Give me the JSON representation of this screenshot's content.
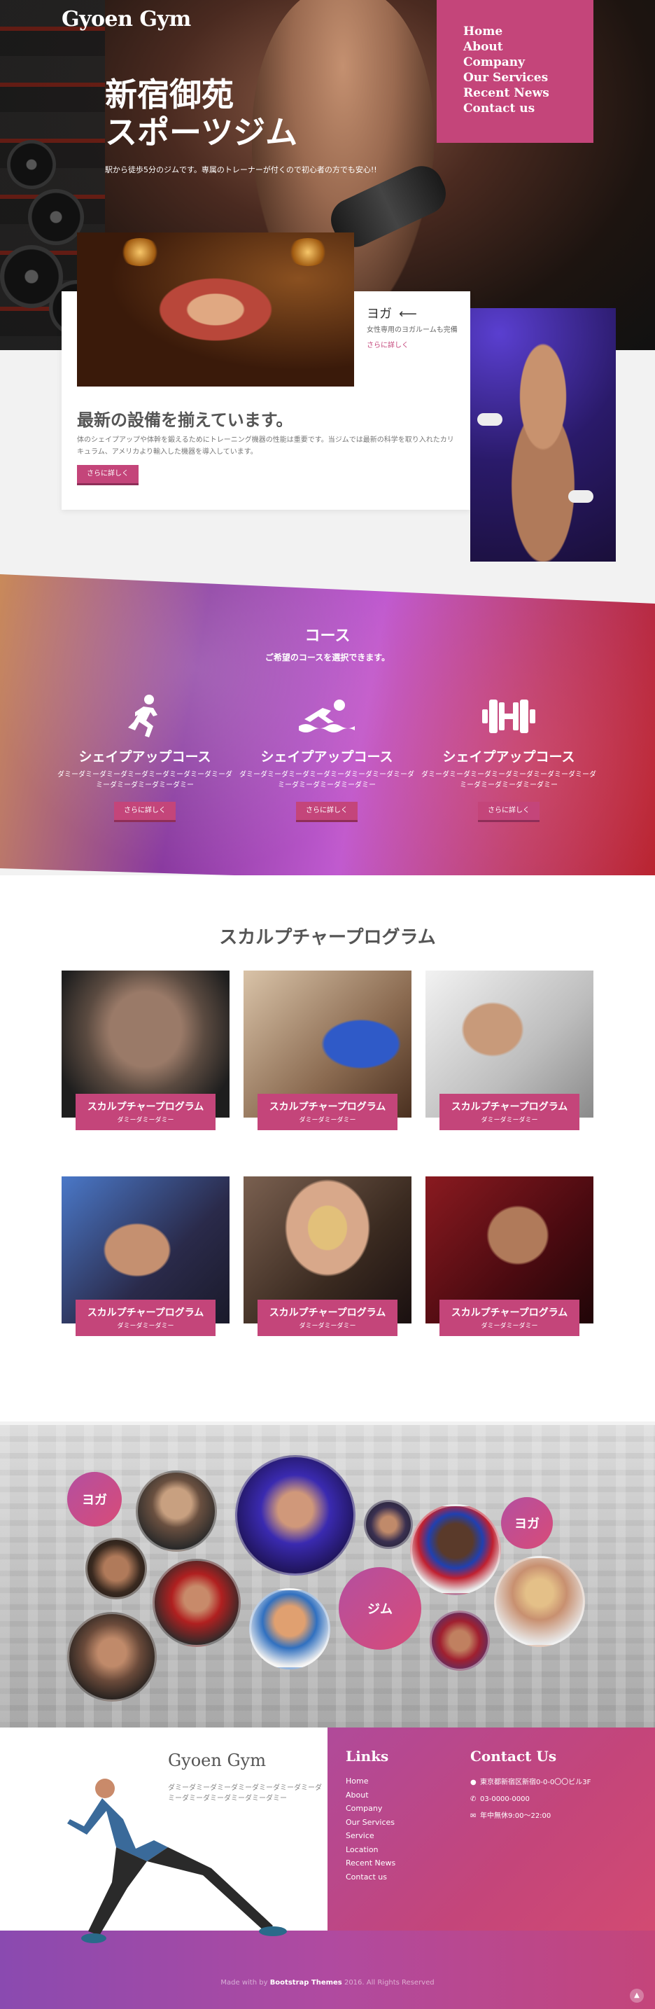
{
  "header": {
    "logo": "Gyoen Gym",
    "nav": [
      "Home",
      "About",
      "Company",
      "Our Services",
      "Recent News",
      "Contact us"
    ]
  },
  "hero": {
    "title_line1": "新宿御苑",
    "title_line2": "スポーツジム",
    "subtitle": "駅から徒歩5分のジムです。専属のトレーナーが付くので初心者の方でも安心!!"
  },
  "feature": {
    "yoga_label": "ヨガ",
    "yoga_arrow": "⟵",
    "yoga_desc": "女性専用のヨガルームも完備",
    "yoga_link": "さらに詳しく",
    "title": "最新の設備を揃えています。",
    "text": "体のシェイプアップや体幹を鍛えるためにトレーニング機器の性能は重要です。当ジムでは最新の科学を取り入れたカリキュラム、アメリカより輸入した機器を導入しています。",
    "button": "さらに詳しく"
  },
  "courses": {
    "title": "コース",
    "subtitle": "ご希望のコースを選択できます。",
    "items": [
      {
        "icon": "running-person-icon",
        "name": "シェイプアップコース",
        "desc": "ダミーダミーダミーダミーダミーダミーダミーダミーダミーダミーダミーダミーダミー",
        "button": "さらに詳しく"
      },
      {
        "icon": "swimming-icon",
        "name": "シェイプアップコース",
        "desc": "ダミーダミーダミーダミーダミーダミーダミーダミーダミーダミーダミーダミーダミー",
        "button": "さらに詳しく"
      },
      {
        "icon": "dumbbell-icon",
        "name": "シェイプアップコース",
        "desc": "ダミーダミーダミーダミーダミーダミーダミーダミーダミーダミーダミーダミーダミー",
        "button": "さらに詳しく"
      }
    ]
  },
  "programs": {
    "title": "スカルプチャープログラム",
    "items": [
      {
        "title": "スカルプチャープログラム",
        "sub": "ダミーダミーダミー"
      },
      {
        "title": "スカルプチャープログラム",
        "sub": "ダミーダミーダミー"
      },
      {
        "title": "スカルプチャープログラム",
        "sub": "ダミーダミーダミー"
      },
      {
        "title": "スカルプチャープログラム",
        "sub": "ダミーダミーダミー"
      },
      {
        "title": "スカルプチャープログラム",
        "sub": "ダミーダミーダミー"
      },
      {
        "title": "スカルプチャープログラム",
        "sub": "ダミーダミーダミー"
      }
    ]
  },
  "gallery": {
    "tags": [
      "ヨガ",
      "ジム",
      "ヨガ"
    ]
  },
  "footer": {
    "logo": "Gyoen Gym",
    "desc": "ダミーダミーダミーダミーダミーダミーダミーダミーダミーダミーダミーダミーダミー",
    "links_title": "Links",
    "links": [
      "Home",
      "About",
      "Company",
      "Our Services",
      "Service",
      "Location",
      "Recent News",
      "Contact us"
    ],
    "contact_title": "Contact Us",
    "address": "東京都新宿区新宿0-0-0〇〇ビル3F",
    "phone": "03-0000-0000",
    "hours": "年中無休9:00〜22:00",
    "copyright_pre": "Made with by",
    "copyright_brand": "Bootstrap Themes",
    "copyright_post": "2016. All Rights Reserved"
  },
  "colors": {
    "accent": "#c4457a",
    "purple": "#8a4ab0"
  }
}
